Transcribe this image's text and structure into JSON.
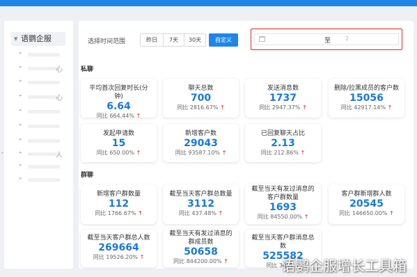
{
  "sidebar": {
    "root_label": "语鹦企服",
    "items": [
      {
        "glyph": ""
      },
      {
        "glyph": "心"
      },
      {
        "glyph": ""
      },
      {
        "glyph": "心"
      },
      {
        "glyph": ""
      },
      {
        "glyph": ""
      },
      {
        "glyph": ""
      },
      {
        "glyph": "人"
      },
      {
        "glyph": ""
      },
      {
        "glyph": ""
      }
    ]
  },
  "filter": {
    "label": "选择时间范围",
    "options": [
      "昨日",
      "7天",
      "30天",
      "自定义"
    ],
    "active": "自定义",
    "date_separator": "至",
    "date_end_placeholder": "2"
  },
  "private_chat": {
    "title": "私聊",
    "cards": [
      {
        "label": "平均首次回复时长(分钟)",
        "value": "6.64",
        "compare": "同比 664.44%"
      },
      {
        "label": "聊天总数",
        "value": "700",
        "compare": "同比 2816.67%"
      },
      {
        "label": "发送消息数",
        "value": "1737",
        "compare": "同比 2947.37%"
      },
      {
        "label": "删除/拉黑成员的客户数",
        "value": "15056",
        "compare": "同比 42917.14%"
      },
      {
        "label": "发起申请数",
        "value": "15",
        "compare": "同比 650.00%"
      },
      {
        "label": "新增客户数",
        "value": "29043",
        "compare": "同比 93587.10%"
      },
      {
        "label": "已回复聊天占比",
        "value": "2.13",
        "compare": "同比 212.86%"
      }
    ]
  },
  "group_chat": {
    "title": "群聊",
    "cards": [
      {
        "label": "新增客户群数量",
        "value": "112",
        "compare": "同比 1766.67%"
      },
      {
        "label": "截至当天客户群总数量",
        "value": "3112",
        "compare": "同比 437.48%"
      },
      {
        "label": "截至当天有发过消息的客户群数量",
        "value": "1693",
        "compare": "同比 84550.00%"
      },
      {
        "label": "客户群新增群人数",
        "value": "20545",
        "compare": "同比 146650.00%"
      },
      {
        "label": "截至当天客户群总人数",
        "value": "269664",
        "compare": "同比 19526.20%"
      },
      {
        "label": "截至当天有发过消息的群成员数",
        "value": "50658",
        "compare": "同比 844200.00%"
      },
      {
        "label": "截至当天客户群消息总数",
        "value": "525582",
        "compare": "同比 3091"
      }
    ]
  },
  "arrow_glyph": "↑",
  "watermark": "语鹦企服增长工具箱",
  "colors": {
    "accent": "#1f86e6",
    "value": "#1a79d6",
    "up": "#e02020",
    "highlight_border": "#e02626"
  }
}
